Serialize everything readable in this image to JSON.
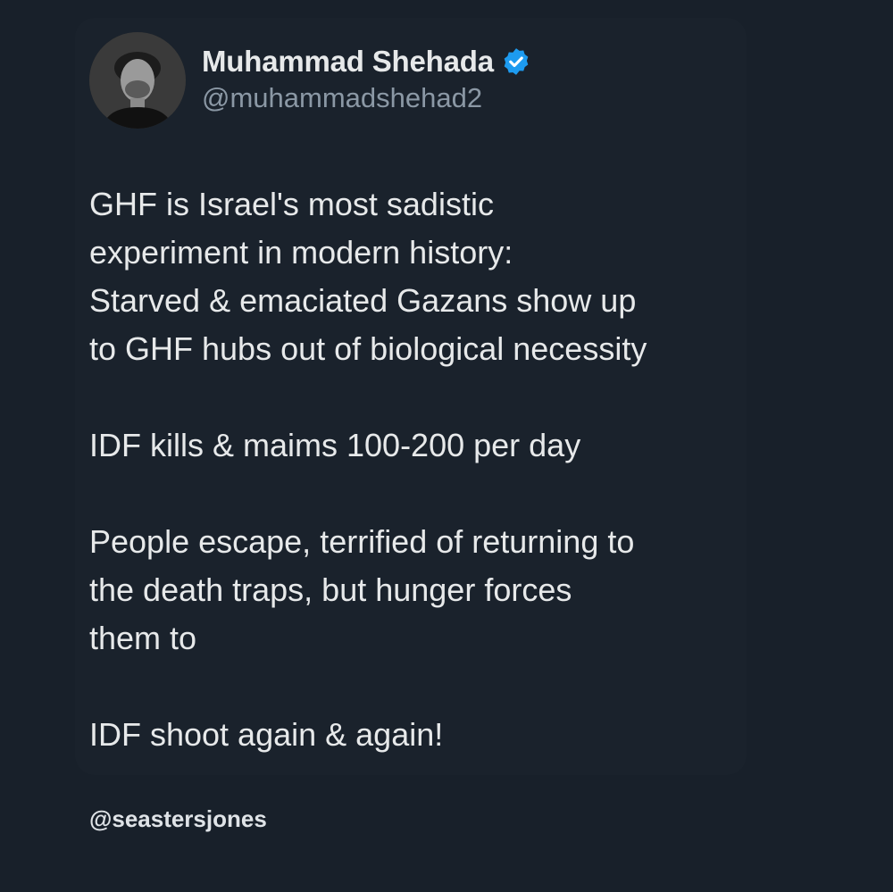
{
  "author": {
    "display_name": "Muhammad Shehada",
    "handle": "@muhammadshehad2",
    "avatar_icon": "profile-photo",
    "verified_icon": "verified-badge-icon",
    "verified_color": "#1d9bf0"
  },
  "tweet": {
    "paragraphs": [
      "GHF is Israel's most sadistic\nexperiment in modern history:\nStarved & emaciated Gazans show up\nto GHF hubs out of biological necessity",
      "IDF kills & maims 100-200 per day",
      "People escape, terrified of returning to\nthe death traps, but hunger forces\nthem to",
      "IDF shoot again & again!"
    ]
  },
  "watermark": "@seastersjones",
  "colors": {
    "background": "#18202a",
    "card": "#1a222c",
    "text": "#e7e9ea",
    "muted": "#8b98a5"
  }
}
